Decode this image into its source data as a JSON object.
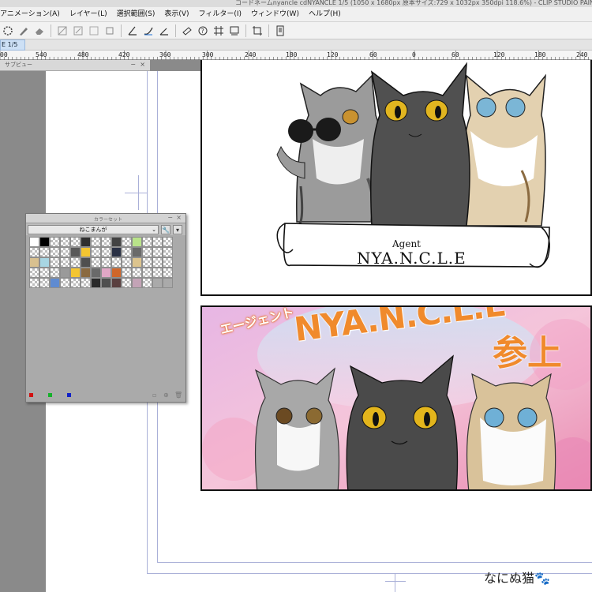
{
  "window": {
    "title": "コードネームnyancle cdNYANCLE 1/5 (1050 x 1680px 原本サイズ:729 x 1032px 350dpi 118.6%) - CLIP STUDIO PAINT"
  },
  "menu": [
    {
      "label": "アニメーション(A)"
    },
    {
      "label": "レイヤー(L)"
    },
    {
      "label": "選択範囲(S)"
    },
    {
      "label": "表示(V)"
    },
    {
      "label": "フィルター(I)"
    },
    {
      "label": "ウィンドウ(W)"
    },
    {
      "label": "ヘルプ(H)"
    }
  ],
  "tab": {
    "label": "E 1/5"
  },
  "ruler": {
    "labels": [
      "00",
      "540",
      "480",
      "420",
      "360",
      "300",
      "240",
      "180",
      "120",
      "60",
      "0",
      "60",
      "120",
      "180",
      "240"
    ]
  },
  "subview": {
    "title": "サブビュー",
    "min": "−",
    "close": "×"
  },
  "colorset": {
    "title": "カラーセット",
    "set_name": "ねこまんが",
    "min": "−",
    "close": "×",
    "rows": [
      [
        "#ffffff",
        "#000000",
        "empty",
        "empty",
        "empty",
        "#2f2f2f",
        "empty",
        "empty",
        "#434343",
        "empty",
        "#b9e38a",
        "empty",
        "empty",
        "empty"
      ],
      [
        "empty",
        "empty",
        "empty",
        "empty",
        "#585858",
        "#f4c531",
        "empty",
        "empty",
        "#2a3145",
        "empty",
        "#6a6a6a",
        "empty",
        "empty",
        "empty"
      ],
      [
        "#d8c08f",
        "#a8d6e3",
        "empty",
        "empty",
        "empty",
        "#4f4f4f",
        "empty",
        "empty",
        "empty",
        "empty",
        "#dcc48e",
        "empty",
        "empty",
        "empty"
      ],
      [
        "empty",
        "empty",
        "empty",
        "#9a9a9a",
        "#f4c531",
        "#8a6a40",
        "#6a6a6a",
        "#e1a7c5",
        "#d0662a",
        "empty",
        "empty",
        "empty",
        "empty",
        "empty"
      ],
      [
        "empty",
        "empty",
        "#5f8bd1",
        "empty",
        "empty",
        "empty",
        "#2a2a2a",
        "#4f4f4f",
        "#5a4040",
        "empty",
        "#c3a3b6",
        "empty",
        "#aaaaaa",
        "#aaaaaa"
      ]
    ],
    "foot_colors": [
      "#d31010",
      "#15b12a",
      "#1020c8"
    ]
  },
  "artwork": {
    "agent_label": "Agent",
    "banner_title": "NYA.N.C.L.E",
    "color_jp": "エージェント",
    "color_title": "NYA.N.C.L.E",
    "color_kanji": "参上"
  },
  "signature": "なにぬ猫🐾"
}
